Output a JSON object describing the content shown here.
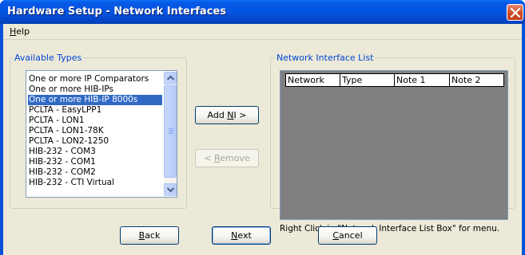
{
  "window": {
    "title": "Hardware Setup - Network Interfaces"
  },
  "menu": {
    "help_label": "Help",
    "help_hotkey": "H",
    "help_rest": "elp"
  },
  "available_types": {
    "legend": "Available Types",
    "items": [
      "One or more IP Comparators",
      "One or more HIB-IPs",
      "One or more HIB-IP 8000s",
      "PCLTA - EasyLPP1",
      "PCLTA - LON1",
      "PCLTA - LON1-78K",
      "PCLTA - LON2-1250",
      "HIB-232 - COM3",
      "HIB-232 - COM1",
      "HIB-232 - COM2",
      "HIB-232 - CTI  Virtual"
    ],
    "selected_index": 2
  },
  "buttons": {
    "add_ni": {
      "pre": "Add ",
      "hotkey": "N",
      "post": "I >"
    },
    "remove": {
      "pre": "< ",
      "hotkey": "R",
      "post": "emove"
    },
    "back": {
      "pre": "",
      "hotkey": "B",
      "post": "ack"
    },
    "next": {
      "pre": "",
      "hotkey": "N",
      "post": "ext"
    },
    "cancel": {
      "pre": "",
      "hotkey": "C",
      "post": "ancel"
    }
  },
  "network_interface_list": {
    "legend": "Network Interface List",
    "columns": [
      "Network",
      "Type",
      "Note 1",
      "Note 2"
    ],
    "hint": "Right Click in \"Network Interface List Box\" for menu."
  },
  "colors": {
    "title_bar": "#0455e0",
    "selection": "#316ac5",
    "legend_text": "#0046d5",
    "close_button": "#d24a26"
  },
  "icons": [
    "close-icon",
    "scroll-up-arrow-icon",
    "scroll-down-arrow-icon",
    "scroll-grip-icon"
  ]
}
